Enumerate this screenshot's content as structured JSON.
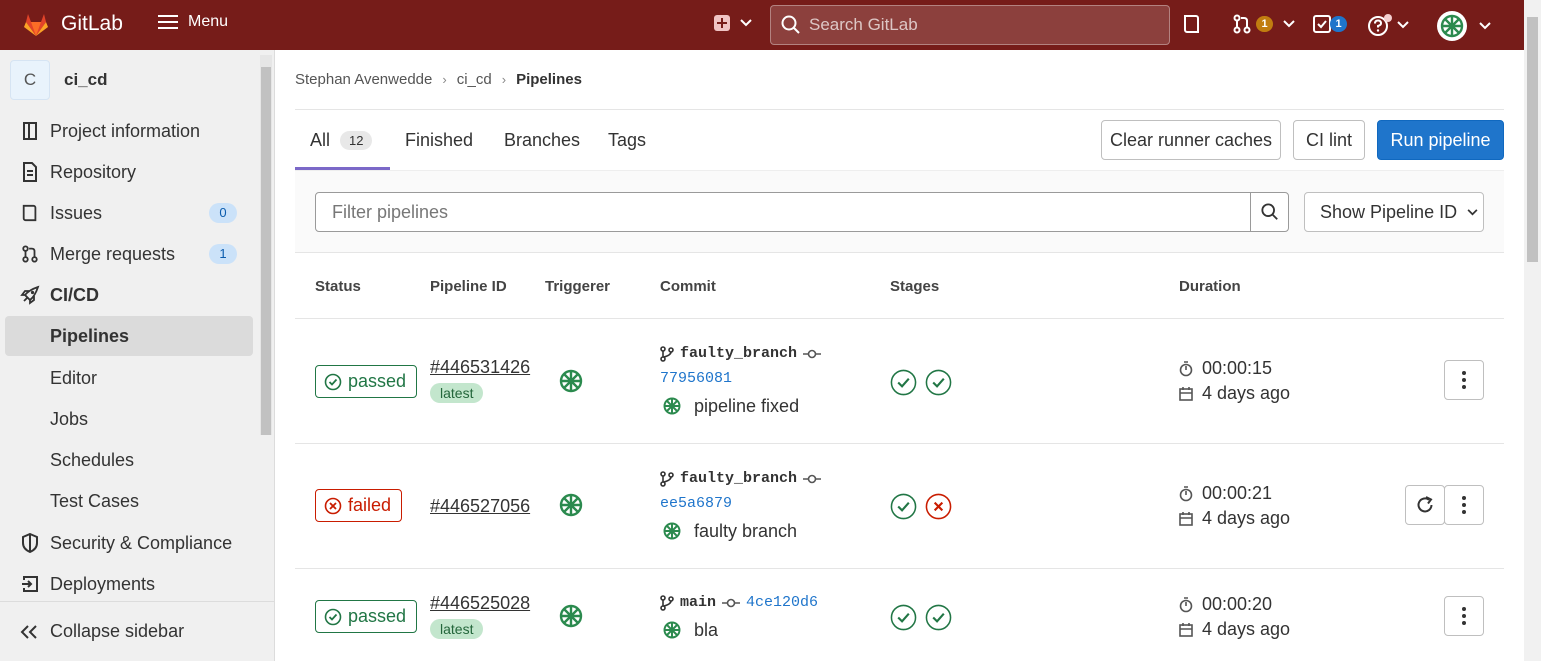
{
  "topbar": {
    "brand": "GitLab",
    "menu_label": "Menu",
    "search_placeholder": "Search GitLab",
    "mr_count": "1",
    "todo_count": "1",
    "bg_color": "#761c19"
  },
  "sidebar": {
    "project_initial": "C",
    "project_name": "ci_cd",
    "items": [
      {
        "label": "Project information",
        "icon": "info-icon"
      },
      {
        "label": "Repository",
        "icon": "doc-icon"
      },
      {
        "label": "Issues",
        "icon": "issues-icon",
        "badge": "0"
      },
      {
        "label": "Merge requests",
        "icon": "merge-request-icon",
        "badge": "1"
      },
      {
        "label": "CI/CD",
        "icon": "rocket-icon"
      },
      {
        "label": "Pipelines"
      },
      {
        "label": "Editor"
      },
      {
        "label": "Jobs"
      },
      {
        "label": "Schedules"
      },
      {
        "label": "Test Cases"
      },
      {
        "label": "Security & Compliance",
        "icon": "shield-icon"
      },
      {
        "label": "Deployments",
        "icon": "deploy-icon"
      }
    ],
    "collapse_label": "Collapse sidebar"
  },
  "breadcrumb": [
    "Stephan Avenwedde",
    "ci_cd",
    "Pipelines"
  ],
  "tabs": {
    "all": "All",
    "all_count": "12",
    "finished": "Finished",
    "branches": "Branches",
    "tags": "Tags"
  },
  "actions": {
    "clear_caches": "Clear runner caches",
    "ci_lint": "CI lint",
    "run_pipeline": "Run pipeline"
  },
  "filter": {
    "placeholder": "Filter pipelines",
    "dropdown": "Show Pipeline ID"
  },
  "table": {
    "headers": [
      "Status",
      "Pipeline ID",
      "Triggerer",
      "Commit",
      "Stages",
      "Duration"
    ],
    "rows": [
      {
        "status": "passed",
        "id": "#446531426",
        "tag": "latest",
        "branch": "faulty_branch",
        "sha": "77956081",
        "message": "pipeline fixed",
        "stages": [
          "success",
          "success"
        ],
        "duration": "00:00:15",
        "finished": "4 days ago"
      },
      {
        "status": "failed",
        "id": "#446527056",
        "tag": "",
        "branch": "faulty_branch",
        "sha": "ee5a6879",
        "message": "faulty branch",
        "stages": [
          "success",
          "failed"
        ],
        "duration": "00:00:21",
        "finished": "4 days ago"
      },
      {
        "status": "passed",
        "id": "#446525028",
        "tag": "latest",
        "branch": "main",
        "sha": "4ce120d6",
        "message": "bla",
        "stages": [
          "success",
          "success"
        ],
        "duration": "00:00:20",
        "finished": "4 days ago"
      }
    ]
  },
  "colors": {
    "success": "#217645",
    "failed": "#c91c00",
    "primary": "#1f75cb"
  }
}
